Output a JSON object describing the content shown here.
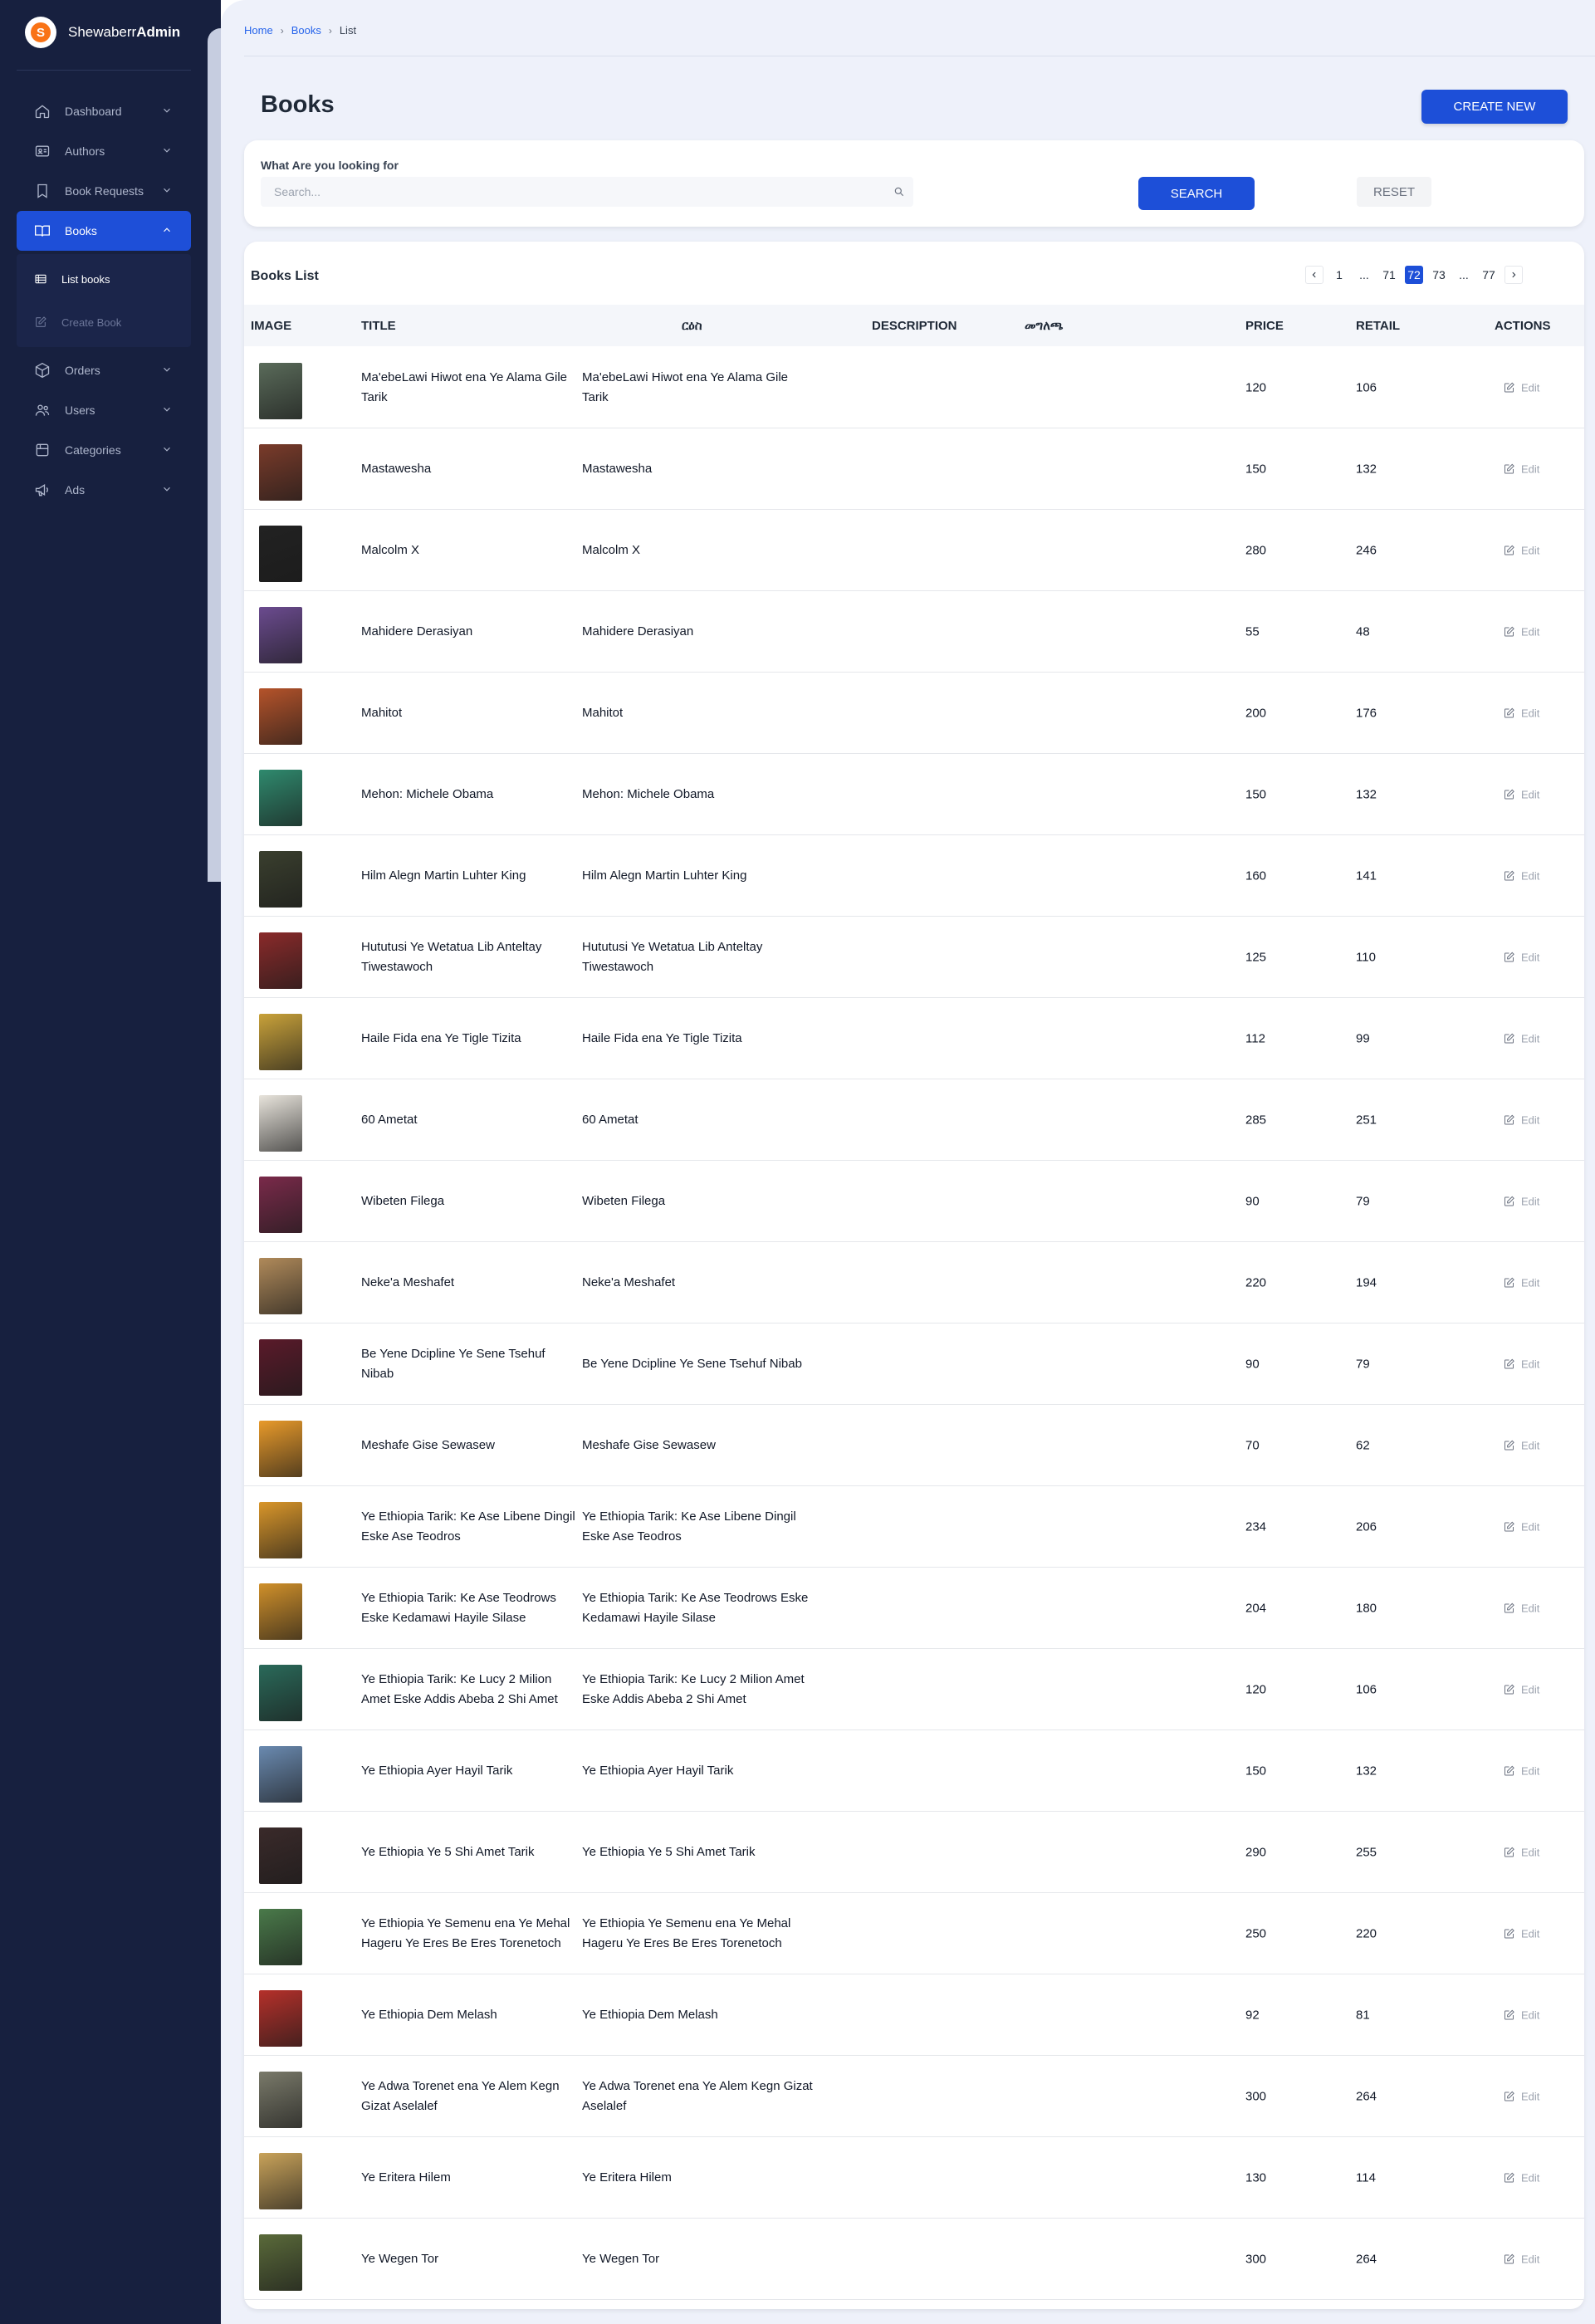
{
  "app": {
    "brand_regular": "Shewaberr",
    "brand_bold": "Admin"
  },
  "sidebar": {
    "items": [
      {
        "label": "Dashboard",
        "icon": "home-icon"
      },
      {
        "label": "Authors",
        "icon": "id-card-icon"
      },
      {
        "label": "Book Requests",
        "icon": "bookmark-icon"
      },
      {
        "label": "Books",
        "icon": "book-open-icon",
        "active": true,
        "children": [
          {
            "label": "List books",
            "icon": "list-icon"
          },
          {
            "label": "Create Book",
            "icon": "edit-icon"
          }
        ]
      },
      {
        "label": "Orders",
        "icon": "box-icon"
      },
      {
        "label": "Users",
        "icon": "users-icon"
      },
      {
        "label": "Categories",
        "icon": "folder-icon"
      },
      {
        "label": "Ads",
        "icon": "megaphone-icon"
      }
    ]
  },
  "breadcrumb": [
    "Home",
    "Books",
    "List"
  ],
  "page": {
    "title": "Books",
    "create_label": "CREATE NEW"
  },
  "search": {
    "label": "What Are you looking for",
    "placeholder": "Search...",
    "value": "",
    "search_label": "SEARCH",
    "reset_label": "RESET"
  },
  "list": {
    "title": "Books List",
    "pagination": {
      "pages": [
        "1",
        "...",
        "71",
        "72",
        "73",
        "...",
        "77"
      ],
      "current": "72"
    },
    "columns": [
      "IMAGE",
      "TITLE",
      "ርዕስ",
      "DESCRIPTION",
      "መግለጫ",
      "PRICE",
      "RETAIL",
      "ACTIONS"
    ],
    "action_label": "Edit",
    "rows": [
      {
        "title": "Ma'ebeLawi Hiwot ena Ye Alama Gile Tarik",
        "title_am": "Ma'ebeLawi Hiwot ena Ye Alama Gile Tarik",
        "price": "120",
        "retail": "106",
        "cover": "#5a6b5a"
      },
      {
        "title": "Mastawesha",
        "title_am": "Mastawesha",
        "price": "150",
        "retail": "132",
        "cover": "#7a3b2a"
      },
      {
        "title": "Malcolm X",
        "title_am": "Malcolm X",
        "price": "280",
        "retail": "246",
        "cover": "#222222"
      },
      {
        "title": "Mahidere Derasiyan",
        "title_am": "Mahidere Derasiyan",
        "price": "55",
        "retail": "48",
        "cover": "#6b4b8f"
      },
      {
        "title": "Mahitot",
        "title_am": "Mahitot",
        "price": "200",
        "retail": "176",
        "cover": "#b5532a"
      },
      {
        "title": "Mehon: Michele Obama",
        "title_am": "Mehon: Michele Obama",
        "price": "150",
        "retail": "132",
        "cover": "#2f8a6e"
      },
      {
        "title": "Hilm Alegn Martin Luhter King",
        "title_am": "Hilm Alegn Martin Luhter King",
        "price": "160",
        "retail": "141",
        "cover": "#3a3f2e"
      },
      {
        "title": "Hututusi Ye Wetatua Lib Anteltay Tiwestawoch",
        "title_am": "Hututusi Ye Wetatua Lib Anteltay Tiwestawoch",
        "price": "125",
        "retail": "110",
        "cover": "#8a2a2a"
      },
      {
        "title": "Haile Fida ena Ye Tigle Tizita",
        "title_am": "Haile Fida ena Ye Tigle Tizita",
        "price": "112",
        "retail": "99",
        "cover": "#c9a23a"
      },
      {
        "title": "60 Ametat",
        "title_am": "60 Ametat",
        "price": "285",
        "retail": "251",
        "cover": "#e8e4dc"
      },
      {
        "title": "Wibeten Filega",
        "title_am": "Wibeten Filega",
        "price": "90",
        "retail": "79",
        "cover": "#7a2a4a"
      },
      {
        "title": "Neke'a Meshafet",
        "title_am": "Neke'a Meshafet",
        "price": "220",
        "retail": "194",
        "cover": "#b08a5a"
      },
      {
        "title": "Be Yene Dcipline Ye Sene Tsehuf Nibab",
        "title_am": "Be Yene Dcipline Ye Sene Tsehuf Nibab",
        "price": "90",
        "retail": "79",
        "cover": "#5a1a2a"
      },
      {
        "title": "Meshafe Gise Sewasew",
        "title_am": "Meshafe Gise Sewasew",
        "price": "70",
        "retail": "62",
        "cover": "#e89a2a"
      },
      {
        "title": "Ye Ethiopia Tarik: Ke Ase Libene Dingil Eske Ase Teodros",
        "title_am": "Ye Ethiopia Tarik: Ke Ase Libene Dingil Eske Ase Teodros",
        "price": "234",
        "retail": "206",
        "cover": "#d9962a"
      },
      {
        "title": "Ye Ethiopia Tarik: Ke Ase Teodrows Eske Kedamawi Hayile Silase",
        "title_am": "Ye Ethiopia Tarik: Ke Ase Teodrows Eske Kedamawi Hayile Silase",
        "price": "204",
        "retail": "180",
        "cover": "#d0902a"
      },
      {
        "title": "Ye Ethiopia Tarik: Ke Lucy 2 Milion Amet Eske Addis Abeba 2 Shi Amet",
        "title_am": "Ye Ethiopia Tarik: Ke Lucy 2 Milion Amet Eske Addis Abeba 2 Shi Amet",
        "price": "120",
        "retail": "106",
        "cover": "#2a6a5a"
      },
      {
        "title": "Ye Ethiopia Ayer Hayil Tarik",
        "title_am": "Ye Ethiopia Ayer Hayil Tarik",
        "price": "150",
        "retail": "132",
        "cover": "#6a8ab0"
      },
      {
        "title": "Ye Ethiopia Ye 5 Shi Amet Tarik",
        "title_am": "Ye Ethiopia Ye 5 Shi Amet Tarik",
        "price": "290",
        "retail": "255",
        "cover": "#3a2a2a"
      },
      {
        "title": "Ye Ethiopia Ye Semenu ena Ye Mehal Hageru Ye Eres Be Eres Torenetoch",
        "title_am": "Ye Ethiopia Ye Semenu ena Ye Mehal Hageru Ye Eres Be Eres Torenetoch",
        "price": "250",
        "retail": "220",
        "cover": "#4a7a4a"
      },
      {
        "title": "Ye Ethiopia Dem Melash",
        "title_am": "Ye Ethiopia Dem Melash",
        "price": "92",
        "retail": "81",
        "cover": "#b5302a"
      },
      {
        "title": "Ye Adwa Torenet ena Ye Alem Kegn Gizat Aselalef",
        "title_am": "Ye Adwa Torenet ena Ye Alem Kegn Gizat Aselalef",
        "price": "300",
        "retail": "264",
        "cover": "#7a7a6a"
      },
      {
        "title": "Ye Eritera Hilem",
        "title_am": "Ye Eritera Hilem",
        "price": "130",
        "retail": "114",
        "cover": "#c9a35a"
      },
      {
        "title": "Ye Wegen Tor",
        "title_am": "Ye Wegen Tor",
        "price": "300",
        "retail": "264",
        "cover": "#5a6a3a"
      }
    ]
  }
}
